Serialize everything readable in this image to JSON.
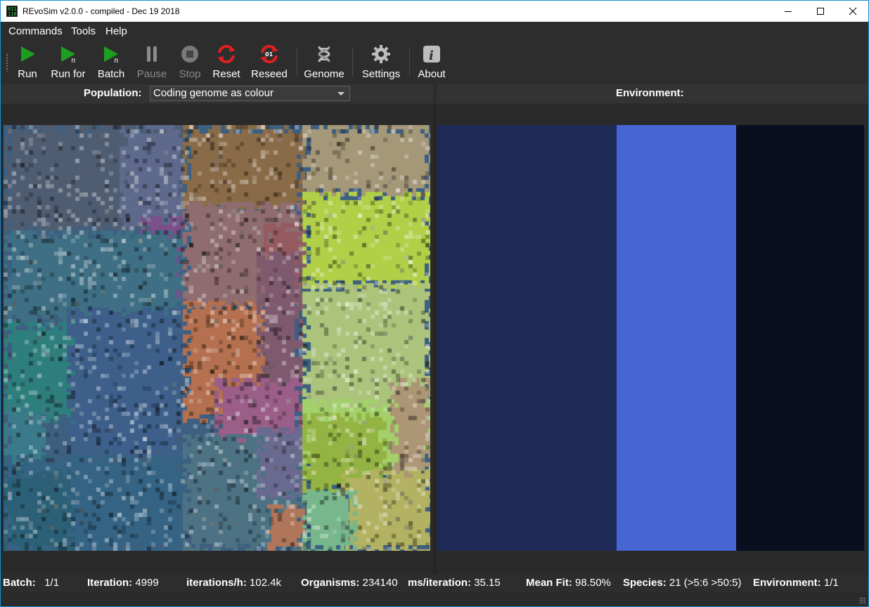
{
  "window": {
    "title": "REvoSim v2.0.0 - compiled - Dec 19 2018",
    "icon_text": "011\n110"
  },
  "menu": [
    "Commands",
    "Tools",
    "Help"
  ],
  "toolbar": {
    "buttons": [
      {
        "label": "Run",
        "icon": "play-icon",
        "enabled": true
      },
      {
        "label": "Run for",
        "icon": "play-n-icon",
        "enabled": true
      },
      {
        "label": "Batch",
        "icon": "play-n-batch-icon",
        "enabled": true
      },
      {
        "label": "Pause",
        "icon": "pause-icon",
        "enabled": false
      },
      {
        "label": "Stop",
        "icon": "stop-icon",
        "enabled": false
      },
      {
        "label": "Reset",
        "icon": "reset-icon",
        "enabled": true
      },
      {
        "label": "Reseed",
        "icon": "reseed-icon",
        "enabled": true
      },
      {
        "label": "Genome",
        "icon": "dna-icon",
        "enabled": true
      },
      {
        "label": "Settings",
        "icon": "gear-icon",
        "enabled": true
      },
      {
        "label": "About",
        "icon": "info-icon",
        "enabled": true
      }
    ],
    "reseed_badge": "01",
    "play_n_glyph": "n",
    "about_glyph": "i"
  },
  "population": {
    "label": "Population:",
    "mode": "Coding genome as colour"
  },
  "environment": {
    "label": "Environment:",
    "bands": [
      "#1e2a58",
      "#4766d3",
      "#090f1e"
    ]
  },
  "status": {
    "batch_label": "Batch:",
    "batch_value": "1/1",
    "iteration_label": "Iteration:",
    "iteration_value": "4999",
    "iph_label": "iterations/h:",
    "iph_value": "102.4k",
    "organisms_label": "Organisms:",
    "organisms_value": "234140",
    "ms_label": "ms/iteration:",
    "ms_value": "35.15",
    "fit_label": "Mean Fit:",
    "fit_value": "98.50%",
    "species_label": "Species:",
    "species_value": "21 (>5:6 >50:5)",
    "env_label": "Environment:",
    "env_value": "1/1"
  },
  "colors": {
    "accent_play": "#1e9e1e",
    "reset_red": "#e02020",
    "window_border": "#1a8fd6"
  }
}
